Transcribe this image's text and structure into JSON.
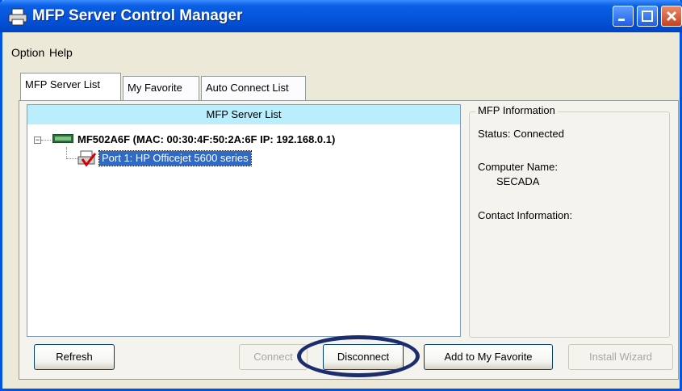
{
  "window": {
    "title": "MFP Server Control Manager"
  },
  "menu": {
    "option": "Option",
    "help": "Help"
  },
  "tabs": [
    {
      "label": "MFP Server List",
      "active": true
    },
    {
      "label": "My Favorite",
      "active": false
    },
    {
      "label": "Auto Connect List",
      "active": false
    }
  ],
  "server_list": {
    "header": "MFP Server List",
    "server": {
      "label": "MF502A6F (MAC: 00:30:4F:50:2A:6F   IP: 192.168.0.1)",
      "expanded": true
    },
    "port": {
      "label": "Port 1: HP Officejet 5600 series",
      "selected": true
    }
  },
  "mfp_info": {
    "legend": "MFP Information",
    "status": "Status: Connected",
    "computer_name_label": "Computer Name:",
    "computer_name": "SECADA",
    "contact_label": "Contact Information:"
  },
  "buttons": {
    "refresh": "Refresh",
    "connect": "Connect",
    "disconnect": "Disconnect",
    "add_favorite": "Add to My Favorite",
    "install_wizard": "Install Wizard"
  },
  "icons": {
    "app": "printer-icon",
    "server": "server-device-icon",
    "port": "printer-check-icon"
  },
  "colors": {
    "titlebar": "#0453d8",
    "list_header": "#bbeefc",
    "selection": "#316ac5",
    "highlight_ellipse": "#1c2d6e"
  }
}
